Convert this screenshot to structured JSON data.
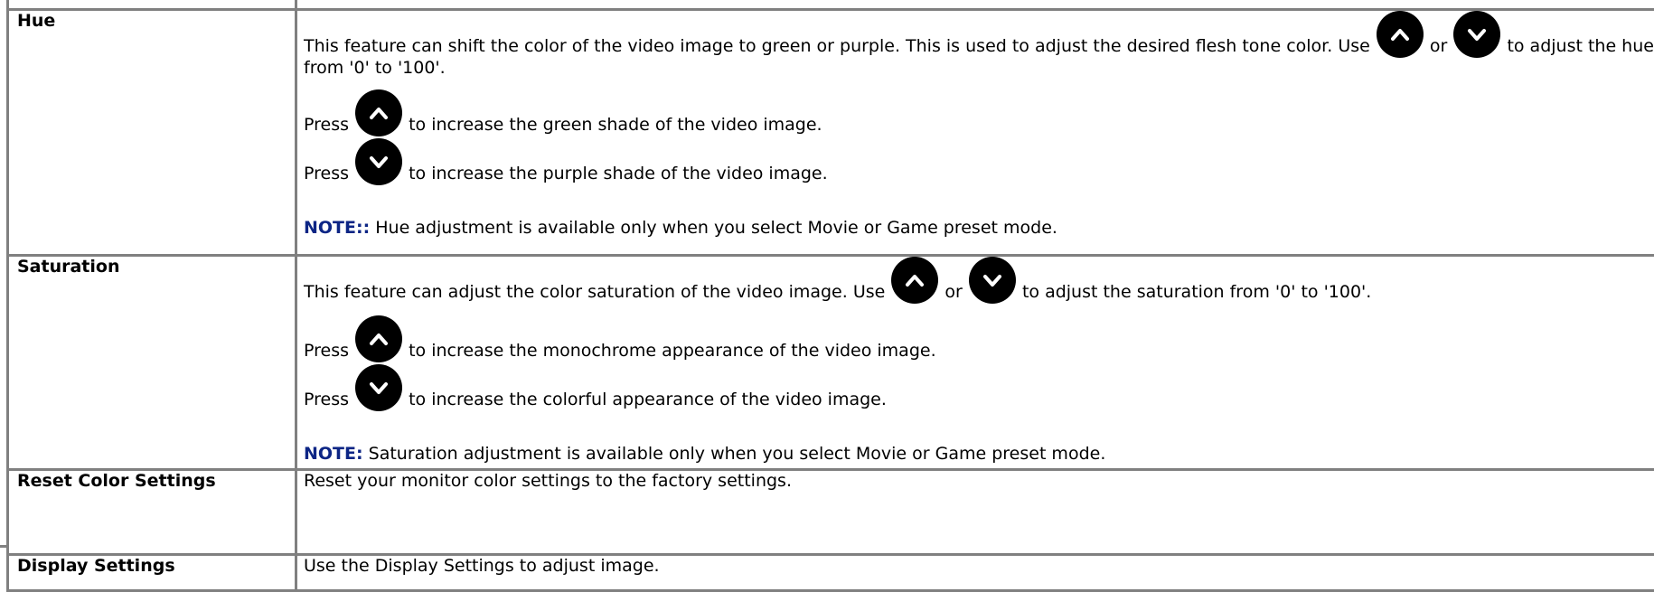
{
  "rows": {
    "hue": {
      "label": "Hue",
      "para1_start": "This feature can shift the color of the video image to green or purple. This is used to adjust the desired flesh tone color. Use",
      "or": "or",
      "para1_end": "to adjust the hue from '0' to '100'.",
      "press": "Press",
      "up_text": "to increase the green shade of the video image.",
      "down_text": "to increase the purple shade of the video image.",
      "note_label": "NOTE::",
      "note_text": " Hue adjustment is available only when you select Movie or Game preset mode."
    },
    "saturation": {
      "label": "Saturation",
      "para1_start": "This feature can adjust the color saturation of the video image. Use",
      "or": "or",
      "para1_end": "to adjust the saturation from '0' to '100'.",
      "press": "Press",
      "up_text": "to increase the monochrome appearance of the video image.",
      "down_text": "to increase the colorful appearance of the video image.",
      "note_label": "NOTE:",
      "note_text": " Saturation adjustment is available only when you select Movie or Game preset mode."
    },
    "reset": {
      "label": "Reset Color Settings",
      "text": "Reset your monitor color settings to the factory settings."
    },
    "display": {
      "label": "Display Settings",
      "text": "Use the Display Settings to adjust image."
    }
  },
  "icons": {
    "up": "chevron-up-icon",
    "down": "chevron-down-icon"
  },
  "colors": {
    "border": "#808080",
    "note": "#0c2585",
    "icon_bg": "#000000",
    "icon_fg": "#ffffff"
  }
}
